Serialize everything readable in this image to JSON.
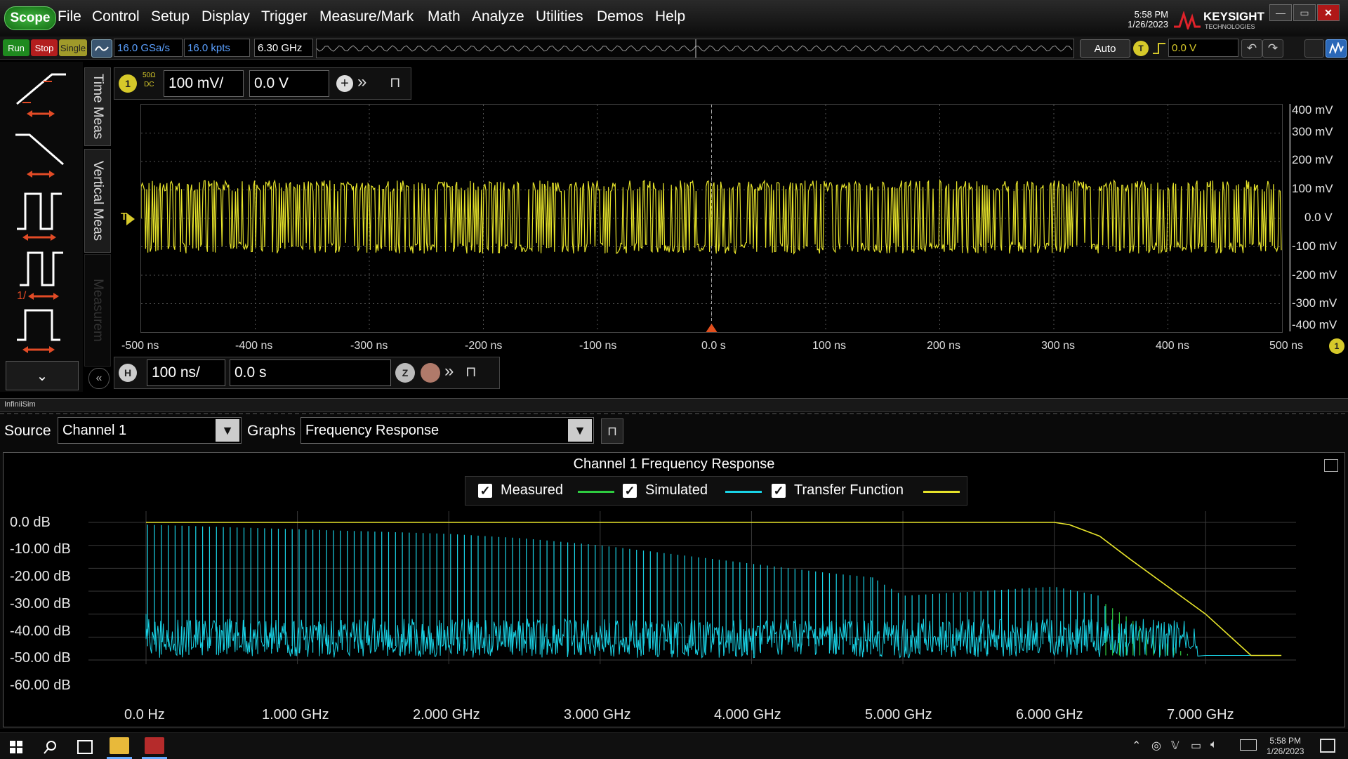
{
  "app": {
    "logo": "Scope",
    "brand": "KEYSIGHT",
    "brand_sub": "TECHNOLOGIES",
    "time": "5:58 PM",
    "date": "1/26/2023"
  },
  "menu": [
    "File",
    "Control",
    "Setup",
    "Display",
    "Trigger",
    "Measure/Mark",
    "Math",
    "Analyze",
    "Utilities",
    "Demos",
    "Help"
  ],
  "toolbar": {
    "run": "Run",
    "stop": "Stop",
    "single": "Single",
    "sample_rate": "16.0 GSa/s",
    "memory_depth": "16.0 kpts",
    "bandwidth": "6.30 GHz",
    "trigger_mode": "Auto",
    "trigger_badge": "T",
    "trigger_level": "0.0 V"
  },
  "side_tabs": [
    "Time Meas",
    "Vertical Meas",
    "Measurem"
  ],
  "channel": {
    "badge": "1",
    "coupling_top": "50Ω",
    "coupling_bottom": "DC",
    "scale": "100 mV/",
    "offset": "0.0 V"
  },
  "waveform": {
    "y_labels": [
      "400 mV",
      "300 mV",
      "200 mV",
      "100 mV",
      "0.0 V",
      "-100 mV",
      "-200 mV",
      "-300 mV",
      "-400 mV"
    ],
    "x_labels": [
      "-500 ns",
      "-400 ns",
      "-300 ns",
      "-200 ns",
      "-100 ns",
      "0.0 s",
      "100 ns",
      "200 ns",
      "300 ns",
      "400 ns",
      "500 ns"
    ],
    "channel_marker": "1",
    "trigger_marker": "T",
    "color": "#e6e32a"
  },
  "horizontal": {
    "badge": "H",
    "scale": "100 ns/",
    "position": "0.0 s",
    "zoom_badge": "Z"
  },
  "infinisim": {
    "panel_title": "InfiniiSim",
    "source_label": "Source",
    "source_value": "Channel 1",
    "graphs_label": "Graphs",
    "graphs_value": "Frequency Response"
  },
  "chart_data": {
    "type": "line",
    "title": "Channel 1 Frequency Response",
    "legend_placement": "top-center",
    "ylabel": "",
    "xlabel": "",
    "x_tick_labels": [
      "0.0 Hz",
      "1.000 GHz",
      "2.000 GHz",
      "3.000 GHz",
      "4.000 GHz",
      "5.000 GHz",
      "6.000 GHz",
      "7.000 GHz"
    ],
    "y_tick_labels": [
      "0.0 dB",
      "-10.00 dB",
      "-20.00 dB",
      "-30.00 dB",
      "-40.00 dB",
      "-50.00 dB",
      "-60.00 dB"
    ],
    "xlim_ghz": [
      0,
      7.5
    ],
    "ylim_db": [
      -60,
      0
    ],
    "grid": true,
    "series": [
      {
        "name": "Measured",
        "color": "#2ecc40",
        "checked": true,
        "x": [
          6.3,
          6.4,
          6.5,
          6.6,
          6.7,
          6.8,
          6.9
        ],
        "y": [
          -34,
          -38,
          -42,
          -47,
          -51,
          -55,
          -58
        ]
      },
      {
        "name": "Simulated",
        "color": "#19d3e6",
        "checked": true,
        "x": [
          0.0,
          0.5,
          1.0,
          1.5,
          2.0,
          2.5,
          3.0,
          3.5,
          4.0,
          4.5,
          4.8,
          5.0,
          5.5,
          6.0,
          6.3,
          6.5,
          7.0,
          7.5
        ],
        "y": [
          -1,
          -2,
          -3,
          -4,
          -5,
          -7,
          -10,
          -14,
          -18,
          -22,
          -24,
          -32,
          -30,
          -28,
          -32,
          -58,
          -58,
          -58
        ]
      },
      {
        "name": "Transfer Function",
        "color": "#e6e32a",
        "checked": true,
        "x": [
          0.0,
          1.0,
          2.0,
          3.0,
          4.0,
          5.0,
          6.0,
          6.1,
          6.3,
          6.5,
          7.0,
          7.3,
          7.5
        ],
        "y": [
          0,
          0,
          0,
          0,
          0,
          0,
          0,
          -1,
          -6,
          -16,
          -40,
          -58,
          -58
        ]
      }
    ]
  }
}
